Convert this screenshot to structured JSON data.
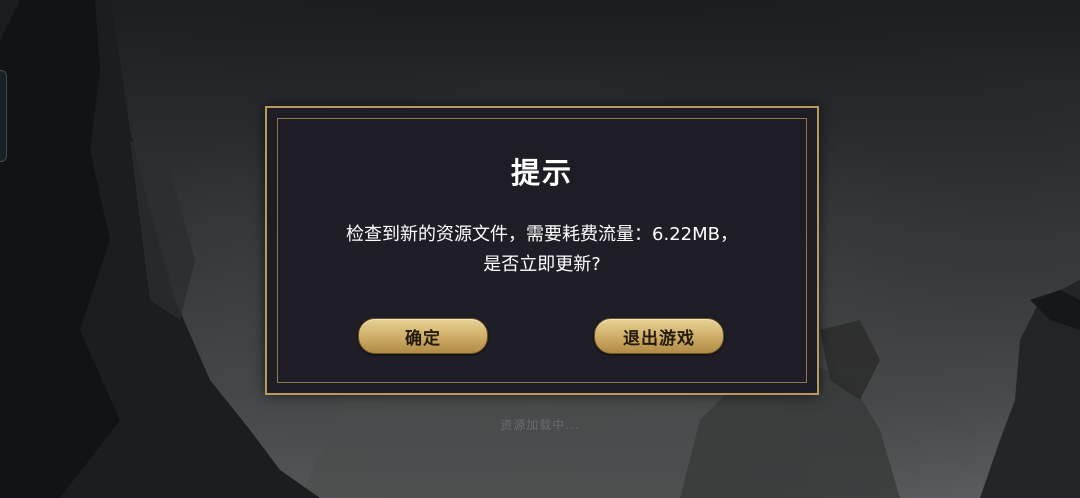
{
  "dialog": {
    "title": "提示",
    "message_line1": "检查到新的资源文件，需要耗费流量：6.22MB，",
    "message_line2": "是否立即更新?",
    "confirm_label": "确定",
    "exit_label": "退出游戏"
  },
  "background": {
    "loading_text": "资源加载中..."
  },
  "colors": {
    "gold_border": "#b79a5d",
    "dialog_bg": "#1e1c24",
    "button_gold": "#cfae67"
  }
}
